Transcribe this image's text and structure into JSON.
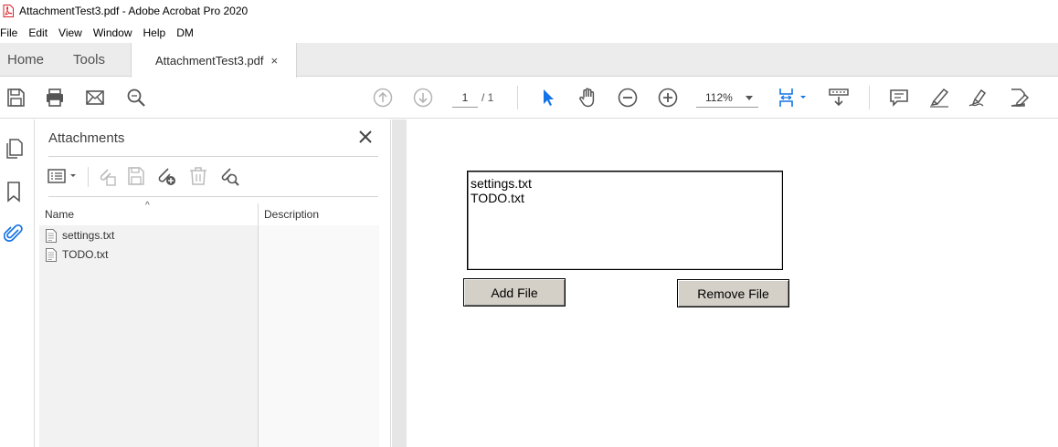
{
  "window": {
    "title": "AttachmentTest3.pdf - Adobe Acrobat Pro 2020",
    "app_icon": "acrobat-pdf-icon"
  },
  "menu": [
    "File",
    "Edit",
    "View",
    "Window",
    "Help",
    "DM"
  ],
  "tabs": {
    "home": "Home",
    "tools": "Tools",
    "document": "AttachmentTest3.pdf",
    "close_glyph": "×"
  },
  "toolbar": {
    "left_icons": [
      "save-icon",
      "print-icon",
      "email-icon",
      "search-icon"
    ],
    "page_current": "1",
    "page_total": "/ 1",
    "zoom": "112%",
    "right_icons": [
      "select-arrow-icon",
      "hand-icon",
      "zoom-out-icon",
      "zoom-in-icon",
      "page-fit-icon",
      "scroll-mode-icon",
      "comment-icon",
      "highlight-icon",
      "sign-icon",
      "edit-pdf-icon"
    ],
    "accent_color": "#1473e6"
  },
  "left_rail": [
    "pages-icon",
    "bookmark-icon",
    "attachment-icon"
  ],
  "attachments_panel": {
    "title": "Attachments",
    "tool_icons": [
      "options-menu-icon",
      "open-file-icon",
      "save-attachment-icon",
      "add-attachment-icon",
      "delete-icon",
      "search-attachment-icon"
    ],
    "columns": {
      "name": "Name",
      "description": "Description"
    },
    "sort_glyph": "^",
    "files": [
      {
        "name": "settings.txt",
        "description": ""
      },
      {
        "name": "TODO.txt",
        "description": ""
      }
    ]
  },
  "form": {
    "listbox_items": [
      "settings.txt",
      "TODO.txt"
    ],
    "add_button": "Add File",
    "remove_button": "Remove File"
  }
}
